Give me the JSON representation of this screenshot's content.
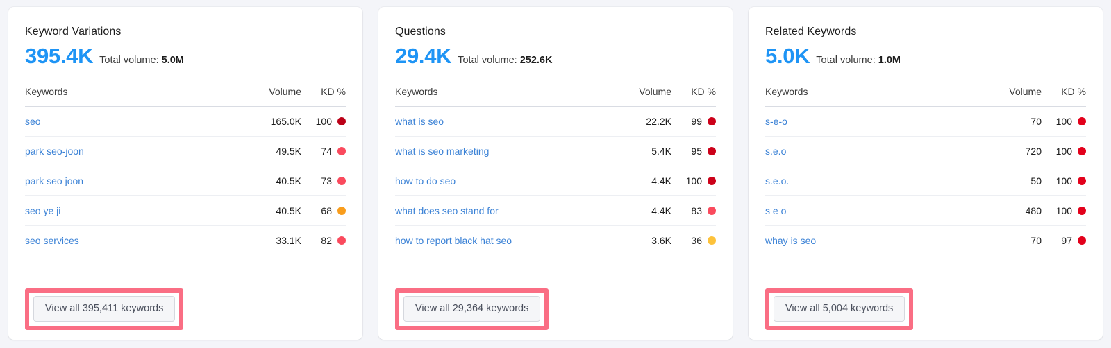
{
  "columns": {
    "keywords": "Keywords",
    "volume": "Volume",
    "kd": "KD %"
  },
  "total_volume_label": "Total volume:",
  "kd_colors": {
    "very_hard": "#bb0017",
    "hard_bright": "#e3001b",
    "difficult": "#fa4a5d",
    "possible": "#f99d1c",
    "easy": "#fdc23b"
  },
  "accent_blue": "#1e94f5",
  "link_blue": "#3b82d6",
  "highlight_color": "#fa6e84",
  "cards": [
    {
      "title": "Keyword Variations",
      "count": "395.4K",
      "total_volume": "5.0M",
      "rows": [
        {
          "keyword": "seo",
          "volume": "165.0K",
          "kd": "100",
          "kd_color": "#bb0017"
        },
        {
          "keyword": "park seo-joon",
          "volume": "49.5K",
          "kd": "74",
          "kd_color": "#fa4a5d"
        },
        {
          "keyword": "park seo joon",
          "volume": "40.5K",
          "kd": "73",
          "kd_color": "#fa4a5d"
        },
        {
          "keyword": "seo ye ji",
          "volume": "40.5K",
          "kd": "68",
          "kd_color": "#f99d1c"
        },
        {
          "keyword": "seo services",
          "volume": "33.1K",
          "kd": "82",
          "kd_color": "#fa4a5d"
        }
      ],
      "button_label": "View all 395,411 keywords"
    },
    {
      "title": "Questions",
      "count": "29.4K",
      "total_volume": "252.6K",
      "rows": [
        {
          "keyword": "what is seo",
          "volume": "22.2K",
          "kd": "99",
          "kd_color": "#cc0019"
        },
        {
          "keyword": "what is seo marketing",
          "volume": "5.4K",
          "kd": "95",
          "kd_color": "#cc0019"
        },
        {
          "keyword": "how to do seo",
          "volume": "4.4K",
          "kd": "100",
          "kd_color": "#cc0019"
        },
        {
          "keyword": "what does seo stand for",
          "volume": "4.4K",
          "kd": "83",
          "kd_color": "#fa4a5d"
        },
        {
          "keyword": "how to report black hat seo",
          "volume": "3.6K",
          "kd": "36",
          "kd_color": "#fdc23b"
        }
      ],
      "button_label": "View all 29,364 keywords"
    },
    {
      "title": "Related Keywords",
      "count": "5.0K",
      "total_volume": "1.0M",
      "rows": [
        {
          "keyword": "s-e-o",
          "volume": "70",
          "kd": "100",
          "kd_color": "#e3001b"
        },
        {
          "keyword": "s.e.o",
          "volume": "720",
          "kd": "100",
          "kd_color": "#e3001b"
        },
        {
          "keyword": "s.e.o.",
          "volume": "50",
          "kd": "100",
          "kd_color": "#e3001b"
        },
        {
          "keyword": "s e o",
          "volume": "480",
          "kd": "100",
          "kd_color": "#e3001b"
        },
        {
          "keyword": "whay is seo",
          "volume": "70",
          "kd": "97",
          "kd_color": "#e3001b"
        }
      ],
      "button_label": "View all 5,004 keywords"
    }
  ]
}
